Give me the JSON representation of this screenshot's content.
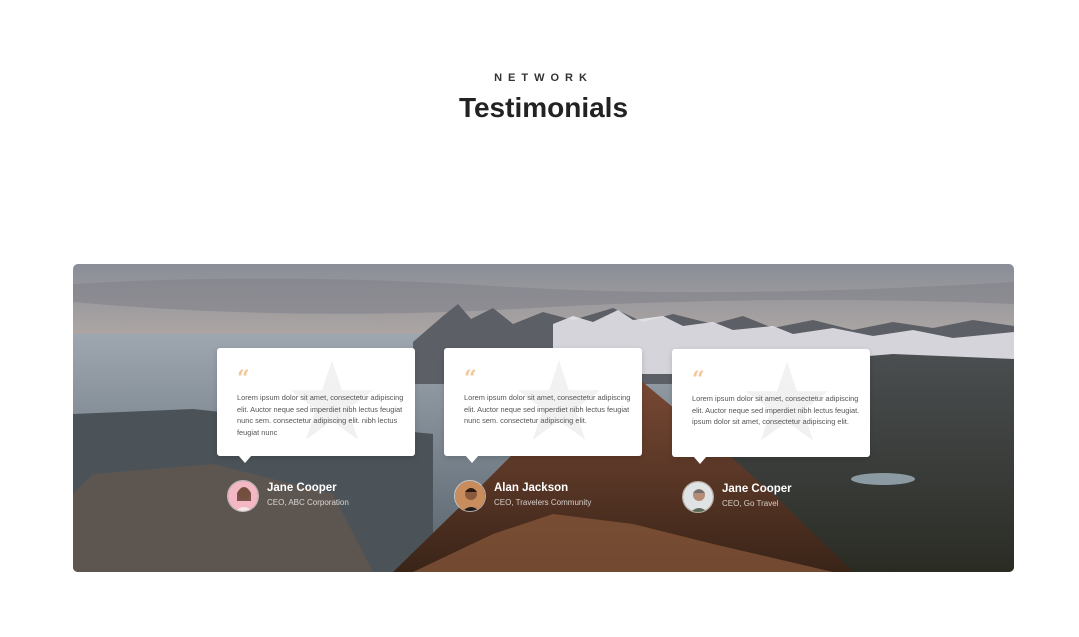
{
  "section": {
    "eyebrow": "NETWORK",
    "title": "Testimonials"
  },
  "colors": {
    "quote_mark": "#f2c79a",
    "card_bg": "#ffffff",
    "heading": "#222222"
  },
  "testimonials": [
    {
      "quote_icon": "quote-icon",
      "text": "Lorem ipsum dolor sit amet, consectetur adipiscing elit. Auctor neque sed imperdiet nibh lectus feugiat nunc sem. consectetur adipiscing elit. nibh lectus feugiat nunc",
      "name": "Jane Cooper",
      "role": "CEO, ABC Corporation"
    },
    {
      "quote_icon": "quote-icon",
      "text": "Lorem ipsum dolor sit amet, consectetur adipiscing elit. Auctor neque sed imperdiet nibh lectus feugiat nunc sem. consectetur adipiscing elit.",
      "name": "Alan Jackson",
      "role": "CEO, Travelers Community"
    },
    {
      "quote_icon": "quote-icon",
      "text": "Lorem ipsum dolor sit amet, consectetur adipiscing elit. Auctor neque sed imperdiet nibh lectus feugiat. ipsum dolor sit amet, consectetur adipiscing elit.",
      "name": "Jane Cooper",
      "role": "CEO, Go Travel"
    }
  ]
}
